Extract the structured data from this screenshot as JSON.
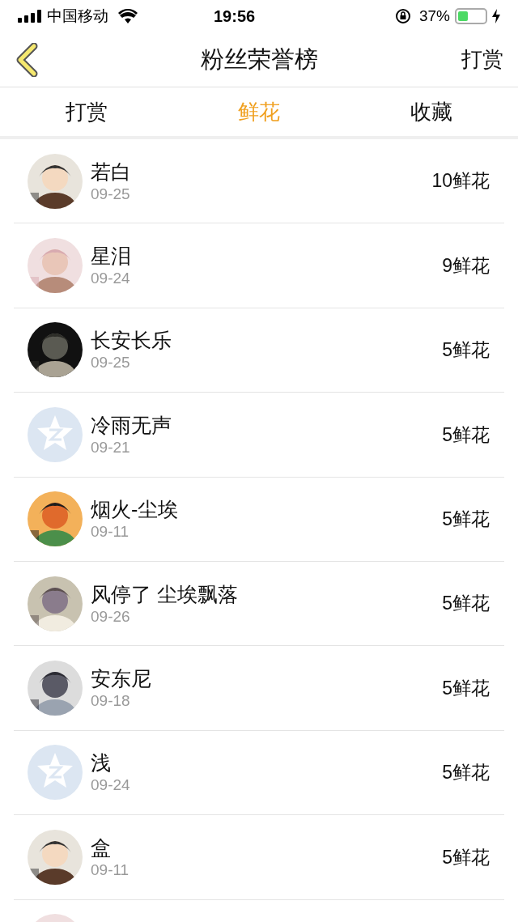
{
  "status_bar": {
    "carrier": "中国移动",
    "time": "19:56",
    "battery": "37%"
  },
  "nav": {
    "title": "粉丝荣誉榜",
    "action": "打赏"
  },
  "tabs": [
    {
      "label": "打赏",
      "selected": false
    },
    {
      "label": "鲜花",
      "selected": true
    },
    {
      "label": "收藏",
      "selected": false
    }
  ],
  "rows": [
    {
      "kind": "picture",
      "name": "若白",
      "date": "09-25",
      "amount": "10鲜花"
    },
    {
      "kind": "picture",
      "name": "星泪",
      "date": "09-24",
      "amount": "9鲜花"
    },
    {
      "kind": "picture",
      "name": "长安长乐",
      "date": "09-25",
      "amount": "5鲜花"
    },
    {
      "kind": "default",
      "name": "冷雨无声",
      "date": "09-21",
      "amount": "5鲜花"
    },
    {
      "kind": "picture",
      "name": "烟火-尘埃",
      "date": "09-11",
      "amount": "5鲜花"
    },
    {
      "kind": "picture",
      "name": "风停了 尘埃飘落",
      "date": "09-26",
      "amount": "5鲜花"
    },
    {
      "kind": "picture",
      "name": "安东尼",
      "date": "09-18",
      "amount": "5鲜花"
    },
    {
      "kind": "default",
      "name": "浅",
      "date": "09-24",
      "amount": "5鲜花"
    },
    {
      "kind": "picture",
      "name": "盒",
      "date": "09-11",
      "amount": "5鲜花"
    },
    {
      "kind": "picture"
    }
  ]
}
